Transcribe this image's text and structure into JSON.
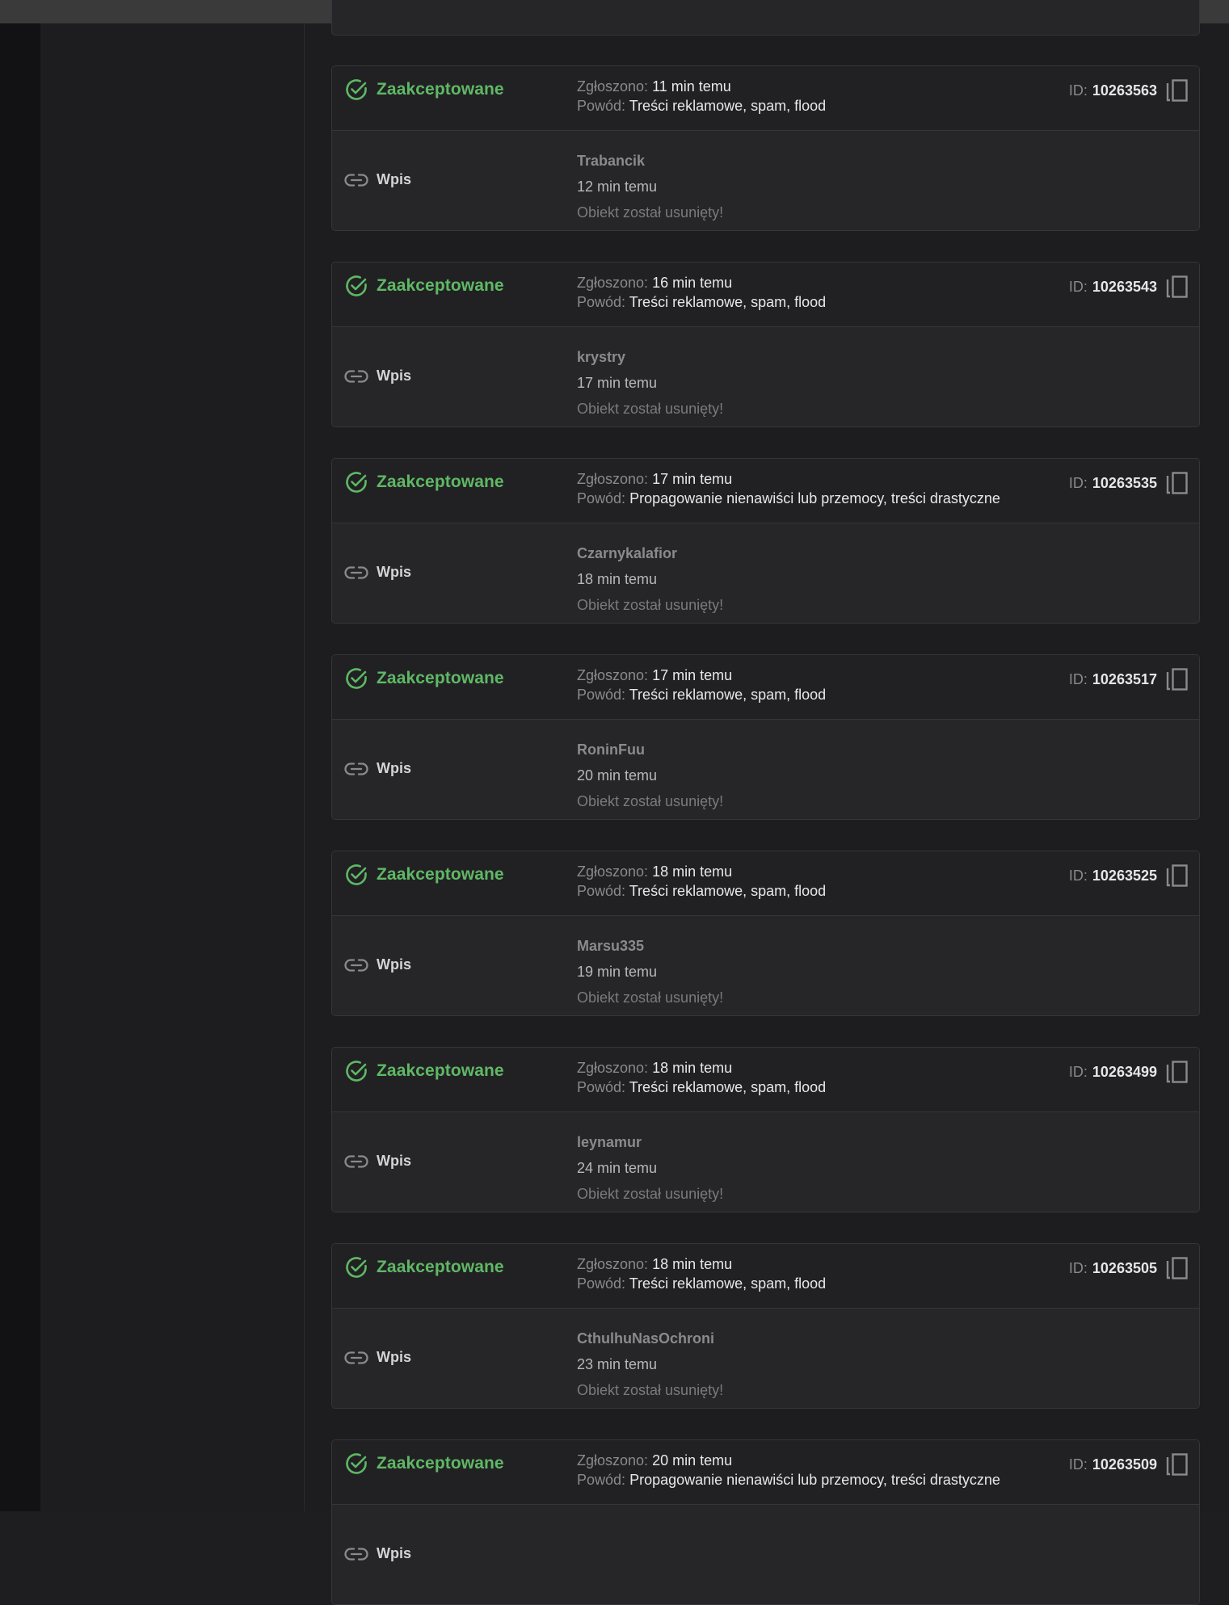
{
  "colors": {
    "accent_green": "#5fb865",
    "background": "#1d1d1f"
  },
  "labels": {
    "reported_prefix": "Zgłoszono:",
    "reason_prefix": "Powód:",
    "id_prefix": "ID:"
  },
  "reports": [
    {
      "status": "Zaakceptowane",
      "reported": "11 min temu",
      "reason": "Treści reklamowe, spam, flood",
      "id": "10263563",
      "type": "Wpis",
      "author": "Trabancik",
      "posted": "12 min temu",
      "object_state": "Obiekt został usunięty!"
    },
    {
      "status": "Zaakceptowane",
      "reported": "16 min temu",
      "reason": "Treści reklamowe, spam, flood",
      "id": "10263543",
      "type": "Wpis",
      "author": "krystry",
      "posted": "17 min temu",
      "object_state": "Obiekt został usunięty!"
    },
    {
      "status": "Zaakceptowane",
      "reported": "17 min temu",
      "reason": "Propagowanie nienawiści lub przemocy, treści drastyczne",
      "id": "10263535",
      "type": "Wpis",
      "author": "Czarnykalafior",
      "posted": "18 min temu",
      "object_state": "Obiekt został usunięty!"
    },
    {
      "status": "Zaakceptowane",
      "reported": "17 min temu",
      "reason": "Treści reklamowe, spam, flood",
      "id": "10263517",
      "type": "Wpis",
      "author": "RoninFuu",
      "posted": "20 min temu",
      "object_state": "Obiekt został usunięty!"
    },
    {
      "status": "Zaakceptowane",
      "reported": "18 min temu",
      "reason": "Treści reklamowe, spam, flood",
      "id": "10263525",
      "type": "Wpis",
      "author": "Marsu335",
      "posted": "19 min temu",
      "object_state": "Obiekt został usunięty!"
    },
    {
      "status": "Zaakceptowane",
      "reported": "18 min temu",
      "reason": "Treści reklamowe, spam, flood",
      "id": "10263499",
      "type": "Wpis",
      "author": "leynamur",
      "posted": "24 min temu",
      "object_state": "Obiekt został usunięty!"
    },
    {
      "status": "Zaakceptowane",
      "reported": "18 min temu",
      "reason": "Treści reklamowe, spam, flood",
      "id": "10263505",
      "type": "Wpis",
      "author": "CthulhuNasOchroni",
      "posted": "23 min temu",
      "object_state": "Obiekt został usunięty!"
    },
    {
      "status": "Zaakceptowane",
      "reported": "20 min temu",
      "reason": "Propagowanie nienawiści lub przemocy, treści drastyczne",
      "id": "10263509",
      "type": "Wpis",
      "author": "",
      "posted": "",
      "object_state": ""
    }
  ]
}
